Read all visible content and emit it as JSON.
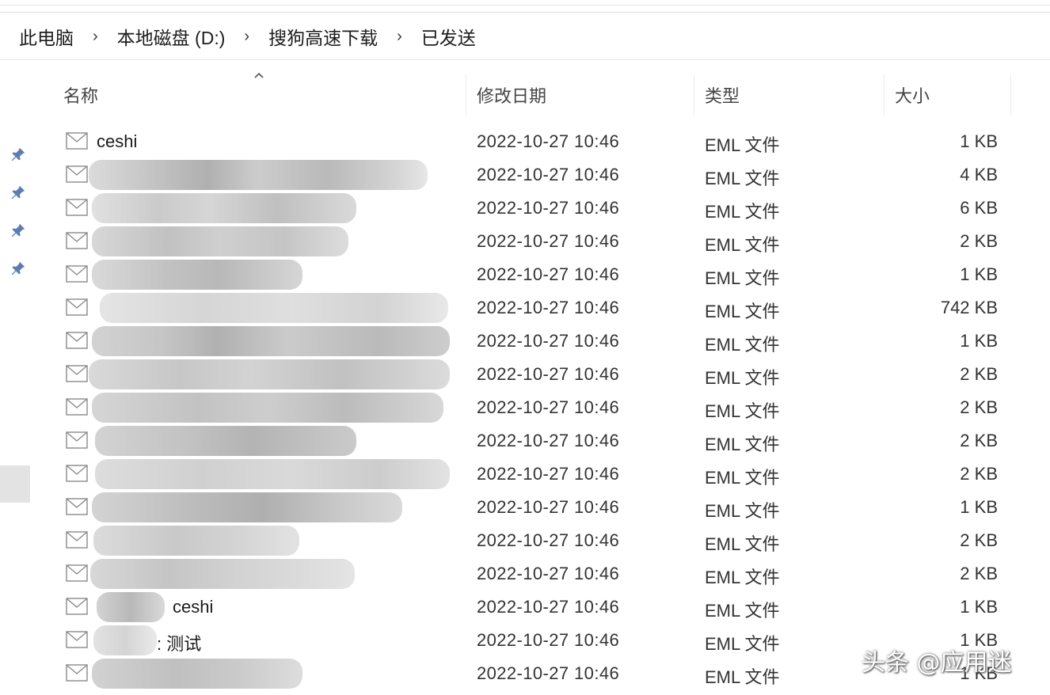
{
  "breadcrumb": [
    "此电脑",
    "本地磁盘 (D:)",
    "搜狗高速下载",
    "已发送"
  ],
  "breadcrumb_separator": "›",
  "columns": {
    "name": "名称",
    "date": "修改日期",
    "type": "类型",
    "size": "大小"
  },
  "files": [
    {
      "name": "ceshi",
      "date": "2022-10-27 10:46",
      "type": "EML 文件",
      "size": "1 KB"
    },
    {
      "name": "",
      "date": "2022-10-27 10:46",
      "type": "EML 文件",
      "size": "4 KB"
    },
    {
      "name": "",
      "date": "2022-10-27 10:46",
      "type": "EML 文件",
      "size": "6 KB"
    },
    {
      "name": "",
      "date": "2022-10-27 10:46",
      "type": "EML 文件",
      "size": "2 KB"
    },
    {
      "name": "",
      "date": "2022-10-27 10:46",
      "type": "EML 文件",
      "size": "1 KB"
    },
    {
      "name": "",
      "date": "2022-10-27 10:46",
      "type": "EML 文件",
      "size": "742 KB"
    },
    {
      "name": "",
      "date": "2022-10-27 10:46",
      "type": "EML 文件",
      "size": "1 KB"
    },
    {
      "name": "",
      "date": "2022-10-27 10:46",
      "type": "EML 文件",
      "size": "2 KB"
    },
    {
      "name": "",
      "date": "2022-10-27 10:46",
      "type": "EML 文件",
      "size": "2 KB"
    },
    {
      "name": "",
      "date": "2022-10-27 10:46",
      "type": "EML 文件",
      "size": "2 KB"
    },
    {
      "name": "",
      "date": "2022-10-27 10:46",
      "type": "EML 文件",
      "size": "2 KB"
    },
    {
      "name": "",
      "date": "2022-10-27 10:46",
      "type": "EML 文件",
      "size": "1 KB"
    },
    {
      "name": "",
      "date": "2022-10-27 10:46",
      "type": "EML 文件",
      "size": "2 KB"
    },
    {
      "name": "",
      "date": "2022-10-27 10:46",
      "type": "EML 文件",
      "size": "2 KB"
    },
    {
      "name": "ceshi",
      "date": "2022-10-27 10:46",
      "type": "EML 文件",
      "size": "1 KB"
    },
    {
      "name": ": 测试",
      "date": "2022-10-27 10:46",
      "type": "EML 文件",
      "size": "1 KB"
    },
    {
      "name": "",
      "date": "2022-10-27 10:46",
      "type": "EML 文件",
      "size": "1 KB"
    }
  ],
  "icons": {
    "file": "mail-envelope-icon",
    "pin": "pin-icon",
    "sort": "sort-ascending-caret-icon"
  },
  "watermark": "头条 @应用迷",
  "colors": {
    "blur_dark": "#b9b9b9",
    "blur_light": "#dcdcdc",
    "pin": "#4a6fa5"
  }
}
